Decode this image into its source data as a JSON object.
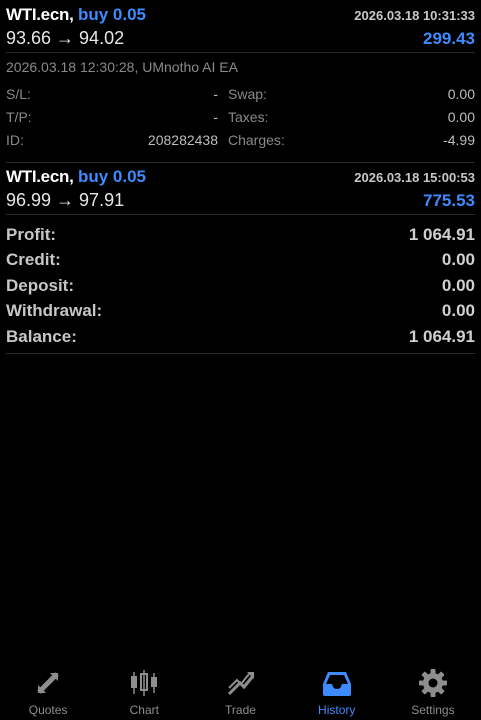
{
  "trades": [
    {
      "symbol": "WTI.ecn,",
      "side": "buy 0.05",
      "datetime": "2026.03.18 10:31:33",
      "prices": "93.66 → 94.02",
      "profit": "299.43",
      "comment": "2026.03.18 12:30:28, UMnotho AI EA",
      "sl_label": "S/L:",
      "sl_value": "-",
      "swap_label": "Swap:",
      "swap_value": "0.00",
      "tp_label": "T/P:",
      "tp_value": "-",
      "taxes_label": "Taxes:",
      "taxes_value": "0.00",
      "id_label": "ID:",
      "id_value": "208282438",
      "charges_label": "Charges:",
      "charges_value": "-4.99"
    },
    {
      "symbol": "WTI.ecn,",
      "side": "buy 0.05",
      "datetime": "2026.03.18 15:00:53",
      "prices": "96.99 → 97.91",
      "profit": "775.53"
    }
  ],
  "summary": [
    {
      "label": "Profit:",
      "value": "1 064.91"
    },
    {
      "label": "Credit:",
      "value": "0.00"
    },
    {
      "label": "Deposit:",
      "value": "0.00"
    },
    {
      "label": "Withdrawal:",
      "value": "0.00"
    },
    {
      "label": "Balance:",
      "value": "1 064.91"
    }
  ],
  "tabs": [
    {
      "label": "Quotes",
      "icon": "quotes-icon"
    },
    {
      "label": "Chart",
      "icon": "chart-icon"
    },
    {
      "label": "Trade",
      "icon": "trade-icon"
    },
    {
      "label": "History",
      "icon": "history-icon",
      "active": true
    },
    {
      "label": "Settings",
      "icon": "settings-icon"
    }
  ],
  "colors": {
    "accent": "#3d8bff",
    "background": "#000000"
  }
}
